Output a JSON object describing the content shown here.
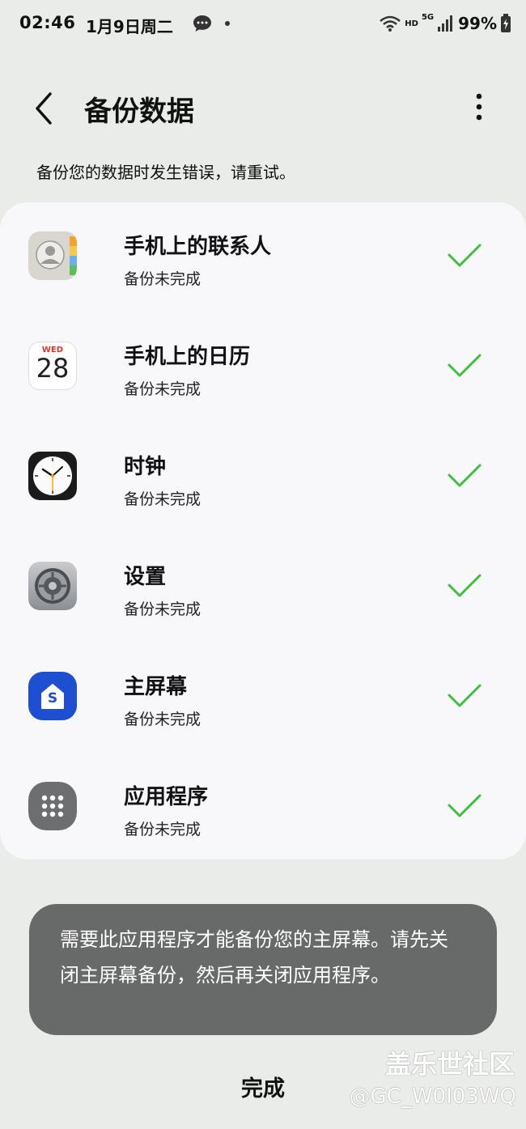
{
  "status_bar": {
    "time": "02:46",
    "date": "1月9日周二",
    "network_hd": "HD",
    "network_5g": "5G",
    "battery": "99%"
  },
  "header": {
    "title": "备份数据"
  },
  "error_message": "备份您的数据时发生错误，请重试。",
  "items": [
    {
      "label": "手机上的联系人",
      "status": "备份未完成",
      "icon": "contacts-icon"
    },
    {
      "label": "手机上的日历",
      "status": "备份未完成",
      "icon": "calendar-icon",
      "calendar_day": "WED",
      "calendar_date": "28"
    },
    {
      "label": "时钟",
      "status": "备份未完成",
      "icon": "clock-icon"
    },
    {
      "label": "设置",
      "status": "备份未完成",
      "icon": "settings-icon"
    },
    {
      "label": "主屏幕",
      "status": "备份未完成",
      "icon": "home-screen-icon",
      "badge_letter": "S"
    },
    {
      "label": "应用程序",
      "status": "备份未完成",
      "icon": "apps-icon"
    }
  ],
  "toast": {
    "message": "需要此应用程序才能备份您的主屏幕。请先关闭主屏幕备份，然后再关闭应用程序。"
  },
  "done_label": "完成",
  "watermark": {
    "line1": "盖乐世社区",
    "line2": "@GC_W0I03WQ"
  },
  "colors": {
    "check": "#3fbf3f",
    "background": "#e9ece8",
    "card": "#f8f8fb",
    "toast": "#686a69"
  }
}
